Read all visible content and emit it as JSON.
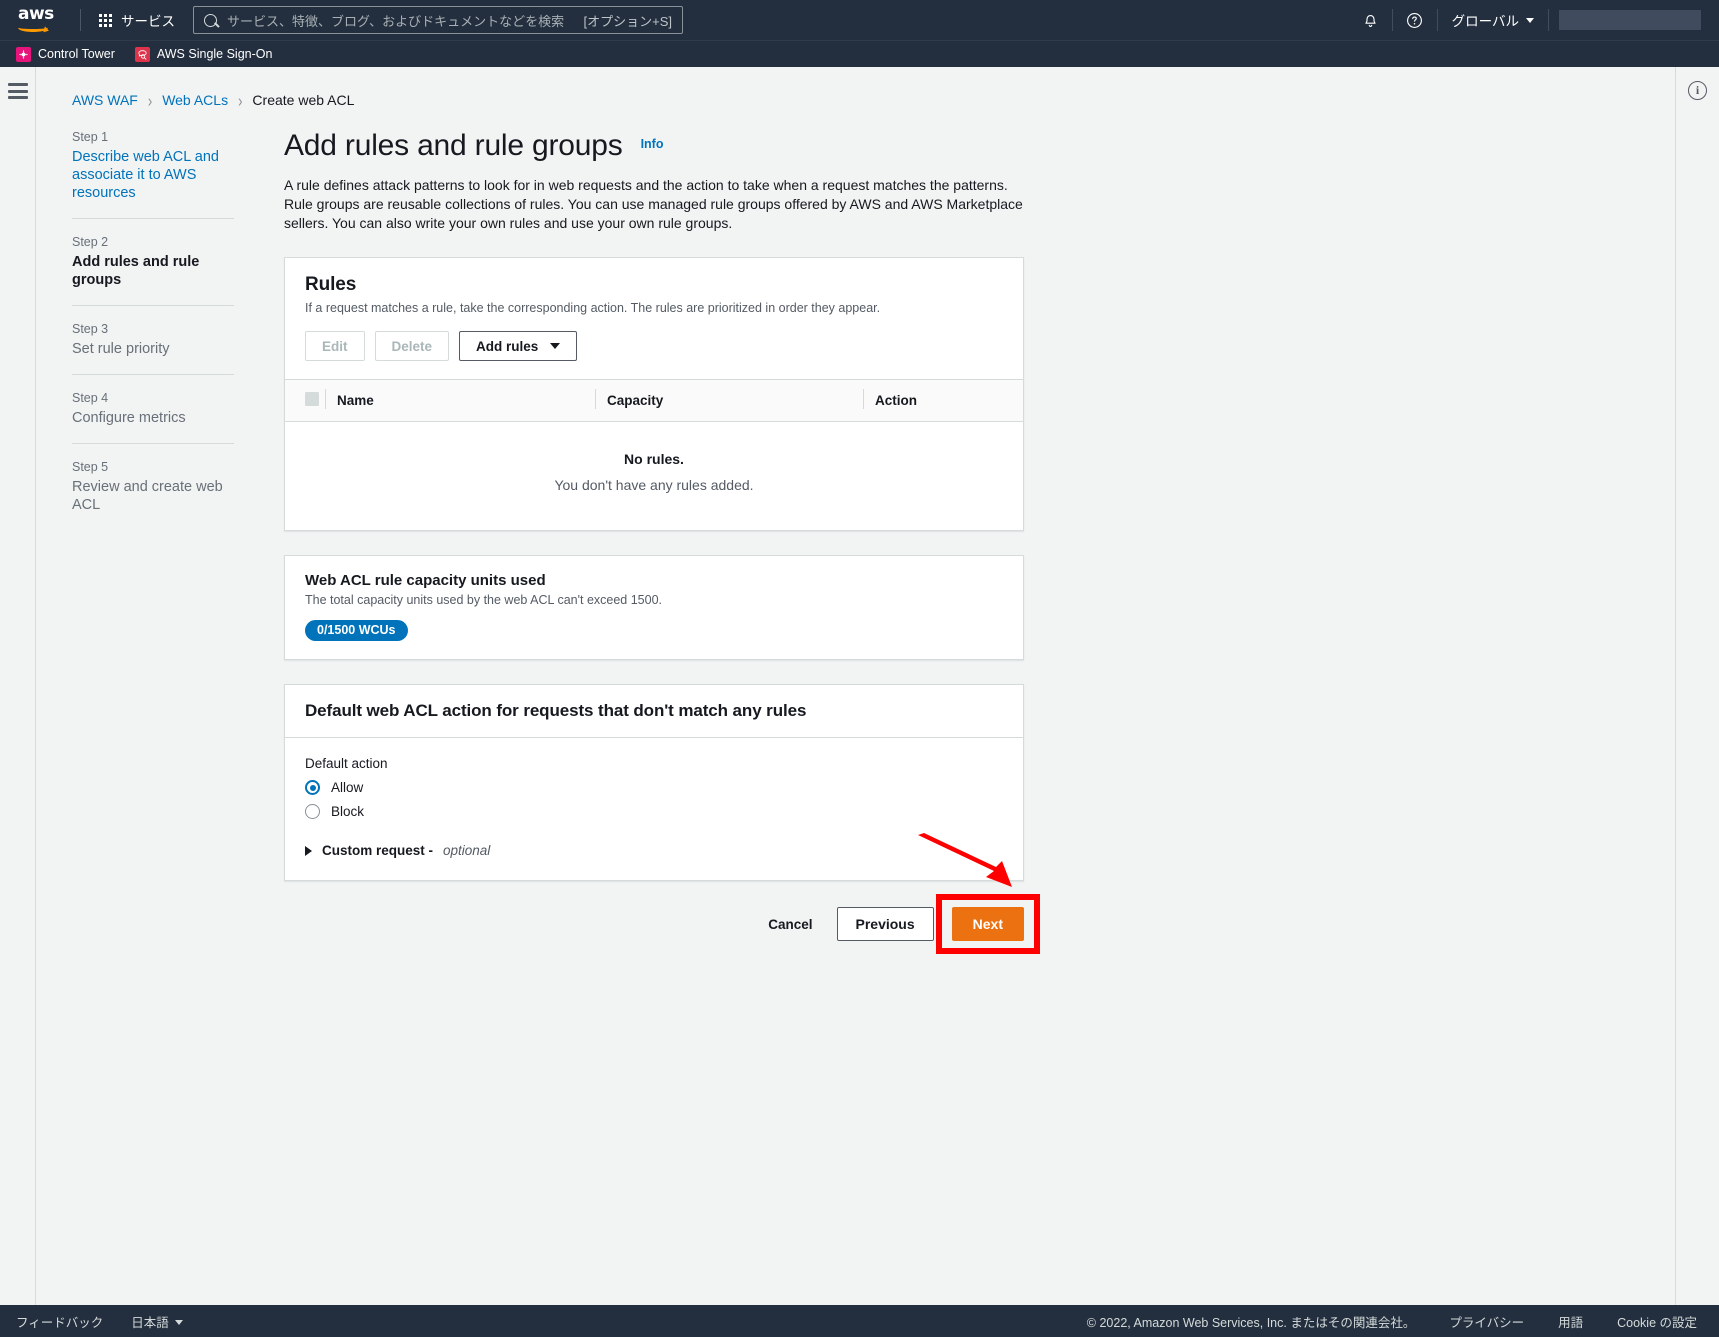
{
  "topnav": {
    "logo_text": "aws",
    "services_label": "サービス",
    "search_placeholder": "サービス、特徴、ブログ、およびドキュメントなどを検索",
    "search_shortcut": "[オプション+S]",
    "notifications_icon": "bell-icon",
    "help_icon": "question-mark-icon",
    "region_label": "グローバル",
    "account_label": ""
  },
  "favorites": [
    {
      "label": "Control Tower",
      "icon": "control-tower-icon"
    },
    {
      "label": "AWS Single Sign-On",
      "icon": "sso-icon"
    }
  ],
  "breadcrumb": [
    {
      "label": "AWS WAF",
      "link": true
    },
    {
      "label": "Web ACLs",
      "link": true
    },
    {
      "label": "Create web ACL",
      "link": false
    }
  ],
  "wizard": {
    "steps": [
      {
        "num": "Step 1",
        "name": "Describe web ACL and associate it to AWS resources",
        "state": "link"
      },
      {
        "num": "Step 2",
        "name": "Add rules and rule groups",
        "state": "active"
      },
      {
        "num": "Step 3",
        "name": "Set rule priority",
        "state": "muted"
      },
      {
        "num": "Step 4",
        "name": "Configure metrics",
        "state": "muted"
      },
      {
        "num": "Step 5",
        "name": "Review and create web ACL",
        "state": "muted"
      }
    ]
  },
  "page": {
    "title": "Add rules and rule groups",
    "info_label": "Info",
    "description": "A rule defines attack patterns to look for in web requests and the action to take when a request matches the patterns. Rule groups are reusable collections of rules. You can use managed rule groups offered by AWS and AWS Marketplace sellers. You can also write your own rules and use your own rule groups."
  },
  "rules_card": {
    "title": "Rules",
    "subtitle": "If a request matches a rule, take the corresponding action. The rules are prioritized in order they appear.",
    "buttons": {
      "edit": "Edit",
      "delete": "Delete",
      "add_rules": "Add rules"
    },
    "columns": [
      "Name",
      "Capacity",
      "Action"
    ],
    "empty_title": "No rules.",
    "empty_sub": "You don't have any rules added."
  },
  "capacity_card": {
    "title": "Web ACL rule capacity units used",
    "subtitle": "The total capacity units used by the web ACL can't exceed 1500.",
    "badge": "0/1500 WCUs",
    "badge_color": "#0073bb",
    "used": 0,
    "limit": 1500
  },
  "default_action_card": {
    "header": "Default web ACL action for requests that don't match any rules",
    "field_label": "Default action",
    "options": [
      {
        "label": "Allow",
        "selected": true
      },
      {
        "label": "Block",
        "selected": false
      }
    ],
    "expander_label": "Custom request -",
    "expander_optional": "optional"
  },
  "form_actions": {
    "cancel": "Cancel",
    "previous": "Previous",
    "next": "Next",
    "next_color": "#ec7211",
    "highlight_color": "#ff0000"
  },
  "right_rail": {
    "info_icon": "info-circle-icon"
  },
  "bottombar": {
    "feedback": "フィードバック",
    "language": "日本語",
    "copyright": "© 2022, Amazon Web Services, Inc. またはその関連会社。",
    "privacy": "プライバシー",
    "terms": "用語",
    "cookies": "Cookie の設定"
  }
}
